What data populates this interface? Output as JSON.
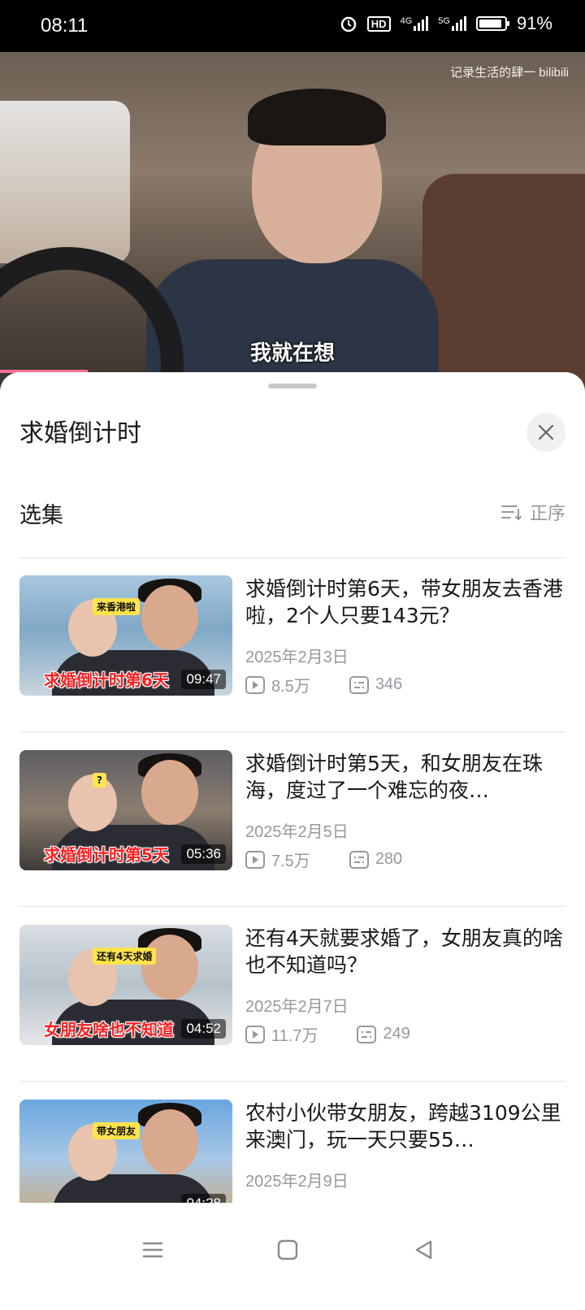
{
  "status_bar": {
    "time": "08:11",
    "hd_label": "HD",
    "network_4g": "4G",
    "network_5g": "5G",
    "battery": "91%",
    "battery_level": 0.91
  },
  "video": {
    "watermark": "记录生活的肆一 bilibili",
    "subtitle": "我就在想",
    "progress": 0.15
  },
  "sheet": {
    "title": "求婚倒计时",
    "section_title": "选集",
    "sort_label": "正序"
  },
  "episodes": [
    {
      "title": "求婚倒计时第6天，带女朋友去香港啦，2个人只要143元？",
      "date": "2025年2月3日",
      "plays": "8.5万",
      "danmaku": "346",
      "duration": "09:47",
      "thumb_caption": "求婚倒计时第6天",
      "thumb_tag": "来香港啦"
    },
    {
      "title": "求婚倒计时第5天，和女朋友在珠海，度过了一个难忘的夜…",
      "date": "2025年2月5日",
      "plays": "7.5万",
      "danmaku": "280",
      "duration": "05:36",
      "thumb_caption": "求婚倒计时第5天",
      "thumb_tag": "?"
    },
    {
      "title": "还有4天就要求婚了，女朋友真的啥也不知道吗？",
      "date": "2025年2月7日",
      "plays": "11.7万",
      "danmaku": "249",
      "duration": "04:52",
      "thumb_caption": "女朋友啥也不知道",
      "thumb_tag": "还有4天求婚"
    },
    {
      "title": "农村小伙带女朋友，跨越3109公里来澳门，玩一天只要55…",
      "date": "2025年2月9日",
      "plays": "",
      "danmaku": "",
      "duration": "04:28",
      "thumb_caption": "",
      "thumb_tag": "带女朋友"
    }
  ],
  "colors": {
    "accent": "#fb7299",
    "text_primary": "#18191c",
    "text_secondary": "#9499a0"
  }
}
